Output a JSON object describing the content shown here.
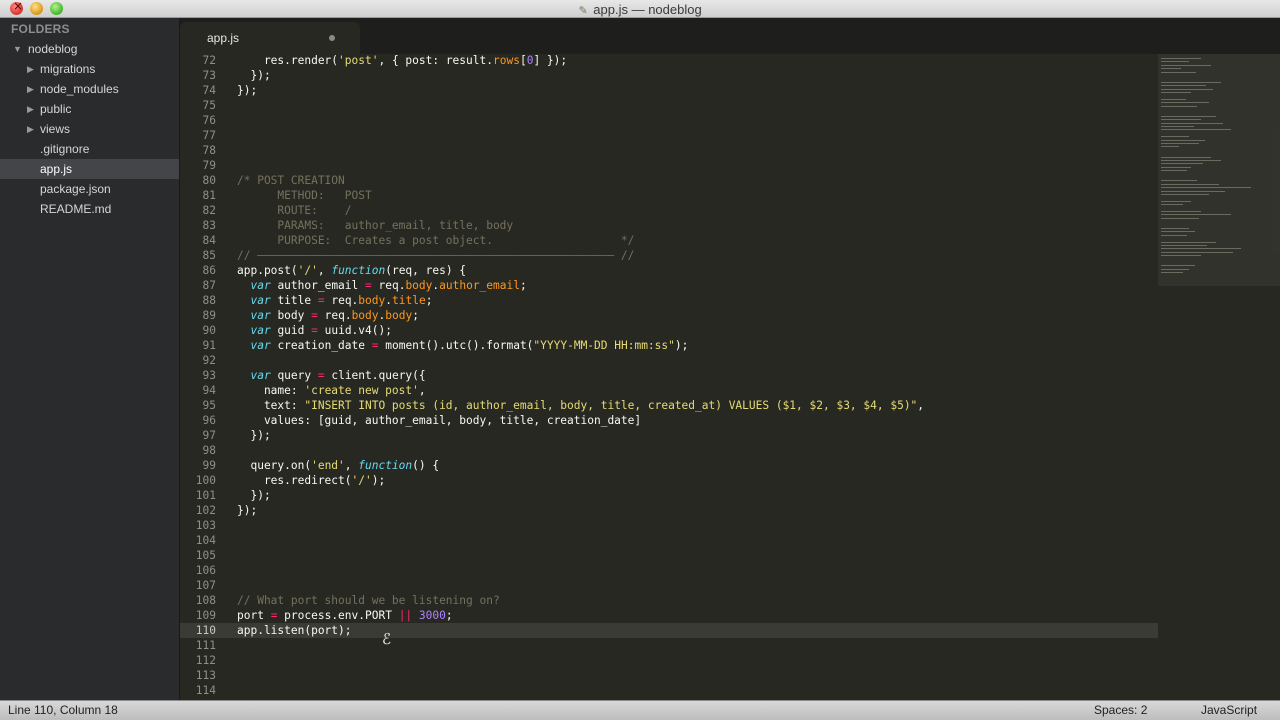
{
  "window": {
    "title": "app.js — nodeblog"
  },
  "sidebar": {
    "header": "FOLDERS",
    "root": "nodeblog",
    "folders": [
      "migrations",
      "node_modules",
      "public",
      "views"
    ],
    "files": [
      ".gitignore",
      "app.js",
      "package.json",
      "README.md"
    ],
    "active_file": "app.js"
  },
  "tabs": [
    {
      "label": "app.js",
      "modified": true
    }
  ],
  "editor": {
    "current_line": 110,
    "lines": [
      {
        "n": "72",
        "t": "    res.render('post', { post: result.rows[0] });"
      },
      {
        "n": "73",
        "t": "  });"
      },
      {
        "n": "74",
        "t": "});"
      },
      {
        "n": "75",
        "t": ""
      },
      {
        "n": "76",
        "t": ""
      },
      {
        "n": "77",
        "t": ""
      },
      {
        "n": "78",
        "t": ""
      },
      {
        "n": "79",
        "t": ""
      },
      {
        "n": "80",
        "t": "/* POST CREATION"
      },
      {
        "n": "81",
        "t": "      METHOD:   POST"
      },
      {
        "n": "82",
        "t": "      ROUTE:    /"
      },
      {
        "n": "83",
        "t": "      PARAMS:   author_email, title, body"
      },
      {
        "n": "84",
        "t": "      PURPOSE:  Creates a post object.                   */"
      },
      {
        "n": "85",
        "t": "// ————————————————————————————————————————————————————— //"
      },
      {
        "n": "86",
        "t": "app.post('/', function(req, res) {"
      },
      {
        "n": "87",
        "t": "  var author_email = req.body.author_email;"
      },
      {
        "n": "88",
        "t": "  var title = req.body.title;"
      },
      {
        "n": "89",
        "t": "  var body = req.body.body;"
      },
      {
        "n": "90",
        "t": "  var guid = uuid.v4();"
      },
      {
        "n": "91",
        "t": "  var creation_date = moment().utc().format(\"YYYY-MM-DD HH:mm:ss\");"
      },
      {
        "n": "92",
        "t": ""
      },
      {
        "n": "93",
        "t": "  var query = client.query({"
      },
      {
        "n": "94",
        "t": "    name: 'create new post',"
      },
      {
        "n": "95",
        "t": "    text: \"INSERT INTO posts (id, author_email, body, title, created_at) VALUES ($1, $2, $3, $4, $5)\","
      },
      {
        "n": "96",
        "t": "    values: [guid, author_email, body, title, creation_date]"
      },
      {
        "n": "97",
        "t": "  });"
      },
      {
        "n": "98",
        "t": ""
      },
      {
        "n": "99",
        "t": "  query.on('end', function() {"
      },
      {
        "n": "100",
        "t": "    res.redirect('/');"
      },
      {
        "n": "101",
        "t": "  });"
      },
      {
        "n": "102",
        "t": "});"
      },
      {
        "n": "103",
        "t": ""
      },
      {
        "n": "104",
        "t": ""
      },
      {
        "n": "105",
        "t": ""
      },
      {
        "n": "106",
        "t": ""
      },
      {
        "n": "107",
        "t": ""
      },
      {
        "n": "108",
        "t": "// What port should we be listening on?"
      },
      {
        "n": "109",
        "t": "port = process.env.PORT || 3000;"
      },
      {
        "n": "110",
        "t": "app.listen(port);"
      },
      {
        "n": "111",
        "t": ""
      },
      {
        "n": "112",
        "t": ""
      },
      {
        "n": "113",
        "t": ""
      },
      {
        "n": "114",
        "t": ""
      }
    ]
  },
  "statusbar": {
    "position": "Line 110, Column 18",
    "indentation": "Spaces: 2",
    "syntax": "JavaScript"
  },
  "colors": {
    "editor_bg": "#272822",
    "keyword": "#66d9ef",
    "string": "#e6db74",
    "number": "#ae81ff",
    "operator": "#f92672",
    "property": "#fd971f",
    "comment": "#75715e"
  }
}
